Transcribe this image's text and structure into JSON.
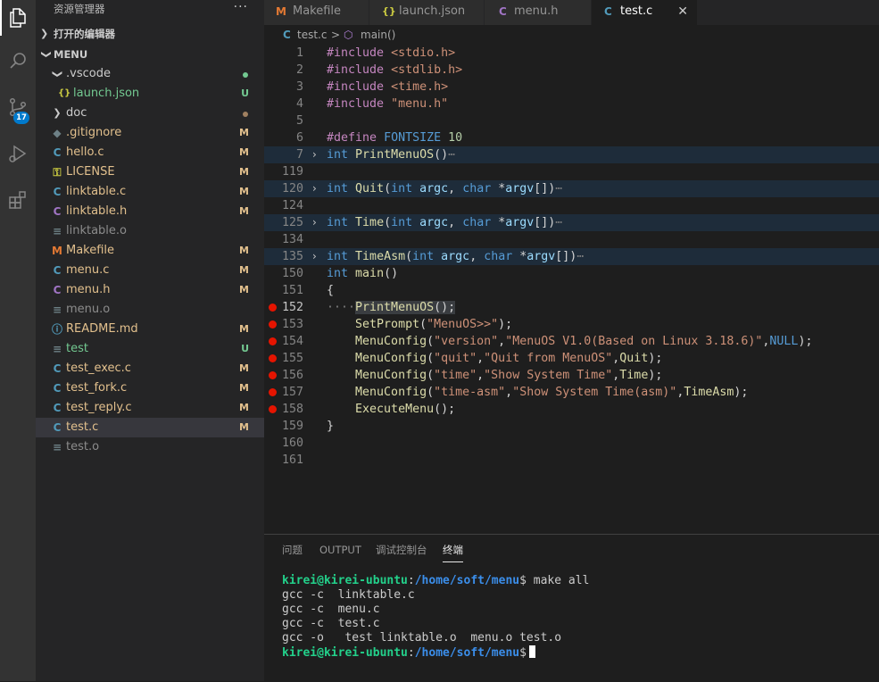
{
  "activity": {
    "badge": "17",
    "icons": [
      "explorer-icon",
      "search-icon",
      "source-control-icon",
      "run-debug-icon",
      "extensions-icon"
    ]
  },
  "sidebar": {
    "title": "资源管理器",
    "more": "···",
    "open_editors": "打开的编辑器",
    "workspace": "MENU",
    "items": [
      {
        "name": ".vscode",
        "icon": "chevron-down",
        "status": "dot"
      },
      {
        "name": "launch.json",
        "icon": "{}",
        "status": "U"
      },
      {
        "name": "doc",
        "icon": "chevron-right",
        "status": "dot"
      },
      {
        "name": ".gitignore",
        "icon": "◆",
        "status": "M"
      },
      {
        "name": "hello.c",
        "icon": "C",
        "status": "M"
      },
      {
        "name": "LICENSE",
        "icon": "⚿",
        "status": "M"
      },
      {
        "name": "linktable.c",
        "icon": "C",
        "status": "M"
      },
      {
        "name": "linktable.h",
        "icon": "C",
        "status": "M"
      },
      {
        "name": "linktable.o",
        "icon": "≡",
        "status": ""
      },
      {
        "name": "Makefile",
        "icon": "M",
        "status": "M"
      },
      {
        "name": "menu.c",
        "icon": "C",
        "status": "M"
      },
      {
        "name": "menu.h",
        "icon": "C",
        "status": "M"
      },
      {
        "name": "menu.o",
        "icon": "≡",
        "status": ""
      },
      {
        "name": "README.md",
        "icon": "ⓘ",
        "status": "M"
      },
      {
        "name": "test",
        "icon": "≡",
        "status": "U"
      },
      {
        "name": "test_exec.c",
        "icon": "C",
        "status": "M"
      },
      {
        "name": "test_fork.c",
        "icon": "C",
        "status": "M"
      },
      {
        "name": "test_reply.c",
        "icon": "C",
        "status": "M"
      },
      {
        "name": "test.c",
        "icon": "C",
        "status": "M"
      },
      {
        "name": "test.o",
        "icon": "≡",
        "status": ""
      }
    ]
  },
  "tabs": [
    {
      "icon": "M",
      "label": "Makefile"
    },
    {
      "icon": "{}",
      "label": "launch.json"
    },
    {
      "icon": "C",
      "label": "menu.h"
    },
    {
      "icon": "C",
      "label": "test.c",
      "close": "✕"
    }
  ],
  "breadcrumb": {
    "file": "test.c",
    "sep": ">",
    "symbol": "main()"
  },
  "editor": {
    "line_numbers": [
      "1",
      "2",
      "3",
      "4",
      "5",
      "6",
      "7",
      "119",
      "120",
      "124",
      "125",
      "134",
      "135",
      "150",
      "151",
      "152",
      "153",
      "154",
      "155",
      "156",
      "157",
      "158",
      "159",
      "160",
      "161"
    ],
    "fold_marker": "›",
    "ellipsis": "⋯",
    "lines": [
      {
        "parts": [
          {
            "c": "pp",
            "t": "#include"
          },
          {
            "c": "",
            "t": " "
          },
          {
            "c": "s",
            "t": "<stdio.h>"
          }
        ]
      },
      {
        "parts": [
          {
            "c": "pp",
            "t": "#include"
          },
          {
            "c": "",
            "t": " "
          },
          {
            "c": "s",
            "t": "<stdlib.h>"
          }
        ]
      },
      {
        "parts": [
          {
            "c": "pp",
            "t": "#include"
          },
          {
            "c": "",
            "t": " "
          },
          {
            "c": "s",
            "t": "<time.h>"
          }
        ]
      },
      {
        "parts": [
          {
            "c": "pp",
            "t": "#include"
          },
          {
            "c": "",
            "t": " "
          },
          {
            "c": "s",
            "t": "\"menu.h\""
          }
        ]
      },
      {
        "parts": []
      },
      {
        "parts": [
          {
            "c": "pp",
            "t": "#define"
          },
          {
            "c": "",
            "t": " "
          },
          {
            "c": "k",
            "t": "FONTSIZE"
          },
          {
            "c": "",
            "t": " "
          },
          {
            "c": "n",
            "t": "10"
          }
        ]
      },
      {
        "parts": [
          {
            "c": "k",
            "t": "int"
          },
          {
            "c": "",
            "t": " "
          },
          {
            "c": "f",
            "t": "PrintMenuOS"
          },
          {
            "c": "",
            "t": "()"
          },
          {
            "c": "dim",
            "t": "⋯"
          }
        ]
      },
      {
        "parts": []
      },
      {
        "parts": [
          {
            "c": "k",
            "t": "int"
          },
          {
            "c": "",
            "t": " "
          },
          {
            "c": "f",
            "t": "Quit"
          },
          {
            "c": "",
            "t": "("
          },
          {
            "c": "k",
            "t": "int"
          },
          {
            "c": "",
            "t": " "
          },
          {
            "c": "v",
            "t": "argc"
          },
          {
            "c": "",
            "t": ", "
          },
          {
            "c": "k",
            "t": "char"
          },
          {
            "c": "",
            "t": " *"
          },
          {
            "c": "v",
            "t": "argv"
          },
          {
            "c": "",
            "t": "[])"
          },
          {
            "c": "dim",
            "t": "⋯"
          }
        ]
      },
      {
        "parts": []
      },
      {
        "parts": [
          {
            "c": "k",
            "t": "int"
          },
          {
            "c": "",
            "t": " "
          },
          {
            "c": "f",
            "t": "Time"
          },
          {
            "c": "",
            "t": "("
          },
          {
            "c": "k",
            "t": "int"
          },
          {
            "c": "",
            "t": " "
          },
          {
            "c": "v",
            "t": "argc"
          },
          {
            "c": "",
            "t": ", "
          },
          {
            "c": "k",
            "t": "char"
          },
          {
            "c": "",
            "t": " *"
          },
          {
            "c": "v",
            "t": "argv"
          },
          {
            "c": "",
            "t": "[])"
          },
          {
            "c": "dim",
            "t": "⋯"
          }
        ]
      },
      {
        "parts": []
      },
      {
        "parts": [
          {
            "c": "k",
            "t": "int"
          },
          {
            "c": "",
            "t": " "
          },
          {
            "c": "f",
            "t": "TimeAsm"
          },
          {
            "c": "",
            "t": "("
          },
          {
            "c": "k",
            "t": "int"
          },
          {
            "c": "",
            "t": " "
          },
          {
            "c": "v",
            "t": "argc"
          },
          {
            "c": "",
            "t": ", "
          },
          {
            "c": "k",
            "t": "char"
          },
          {
            "c": "",
            "t": " *"
          },
          {
            "c": "v",
            "t": "argv"
          },
          {
            "c": "",
            "t": "[])"
          },
          {
            "c": "dim",
            "t": "⋯"
          }
        ]
      },
      {
        "parts": [
          {
            "c": "k",
            "t": "int"
          },
          {
            "c": "",
            "t": " "
          },
          {
            "c": "f",
            "t": "main"
          },
          {
            "c": "",
            "t": "()"
          }
        ]
      },
      {
        "parts": [
          {
            "c": "",
            "t": "{"
          }
        ]
      },
      {
        "parts": [
          {
            "c": "dim",
            "t": "····"
          },
          {
            "c": "f hl",
            "t": "PrintMenuOS"
          },
          {
            "c": "hl",
            "t": "();"
          }
        ]
      },
      {
        "parts": [
          {
            "c": "",
            "t": "    "
          },
          {
            "c": "f",
            "t": "SetPrompt"
          },
          {
            "c": "",
            "t": "("
          },
          {
            "c": "s",
            "t": "\"MenuOS>>\""
          },
          {
            "c": "",
            "t": ");"
          }
        ]
      },
      {
        "parts": [
          {
            "c": "",
            "t": "    "
          },
          {
            "c": "f",
            "t": "MenuConfig"
          },
          {
            "c": "",
            "t": "("
          },
          {
            "c": "s",
            "t": "\"version\""
          },
          {
            "c": "",
            "t": ","
          },
          {
            "c": "s",
            "t": "\"MenuOS V1.0(Based on Linux 3.18.6)\""
          },
          {
            "c": "",
            "t": ","
          },
          {
            "c": "k",
            "t": "NULL"
          },
          {
            "c": "",
            "t": ");"
          }
        ]
      },
      {
        "parts": [
          {
            "c": "",
            "t": "    "
          },
          {
            "c": "f",
            "t": "MenuConfig"
          },
          {
            "c": "",
            "t": "("
          },
          {
            "c": "s",
            "t": "\"quit\""
          },
          {
            "c": "",
            "t": ","
          },
          {
            "c": "s",
            "t": "\"Quit from MenuOS\""
          },
          {
            "c": "",
            "t": ","
          },
          {
            "c": "f",
            "t": "Quit"
          },
          {
            "c": "",
            "t": ");"
          }
        ]
      },
      {
        "parts": [
          {
            "c": "",
            "t": "    "
          },
          {
            "c": "f",
            "t": "MenuConfig"
          },
          {
            "c": "",
            "t": "("
          },
          {
            "c": "s",
            "t": "\"time\""
          },
          {
            "c": "",
            "t": ","
          },
          {
            "c": "s",
            "t": "\"Show System Time\""
          },
          {
            "c": "",
            "t": ","
          },
          {
            "c": "f",
            "t": "Time"
          },
          {
            "c": "",
            "t": ");"
          }
        ]
      },
      {
        "parts": [
          {
            "c": "",
            "t": "    "
          },
          {
            "c": "f",
            "t": "MenuConfig"
          },
          {
            "c": "",
            "t": "("
          },
          {
            "c": "s",
            "t": "\"time-asm\""
          },
          {
            "c": "",
            "t": ","
          },
          {
            "c": "s",
            "t": "\"Show System Time(asm)\""
          },
          {
            "c": "",
            "t": ","
          },
          {
            "c": "f",
            "t": "TimeAsm"
          },
          {
            "c": "",
            "t": ");"
          }
        ]
      },
      {
        "parts": [
          {
            "c": "",
            "t": "    "
          },
          {
            "c": "f",
            "t": "ExecuteMenu"
          },
          {
            "c": "",
            "t": "();"
          }
        ]
      },
      {
        "parts": [
          {
            "c": "",
            "t": "}"
          }
        ]
      },
      {
        "parts": []
      },
      {
        "parts": []
      }
    ],
    "fold_rows": [
      6,
      8,
      10,
      12
    ],
    "breakpoint_rows": [
      15,
      16,
      17,
      18,
      19,
      20,
      21
    ],
    "current_row": 15
  },
  "panel": {
    "tabs": [
      "问题",
      "OUTPUT",
      "调试控制台",
      "终端"
    ],
    "active_tab": "终端",
    "terminal": {
      "user_host": "kirei@kirei-ubuntu",
      "path": "/home/soft/menu",
      "command": "make all",
      "output": [
        "gcc -c  linktable.c",
        "gcc -c  menu.c",
        "gcc -c  test.c",
        "gcc -o   test linktable.o  menu.o test.o"
      ]
    }
  },
  "colors": {
    "accent": "#007acc",
    "modified": "#e2c08d",
    "untracked": "#73c991",
    "breakpoint": "#e51400"
  }
}
